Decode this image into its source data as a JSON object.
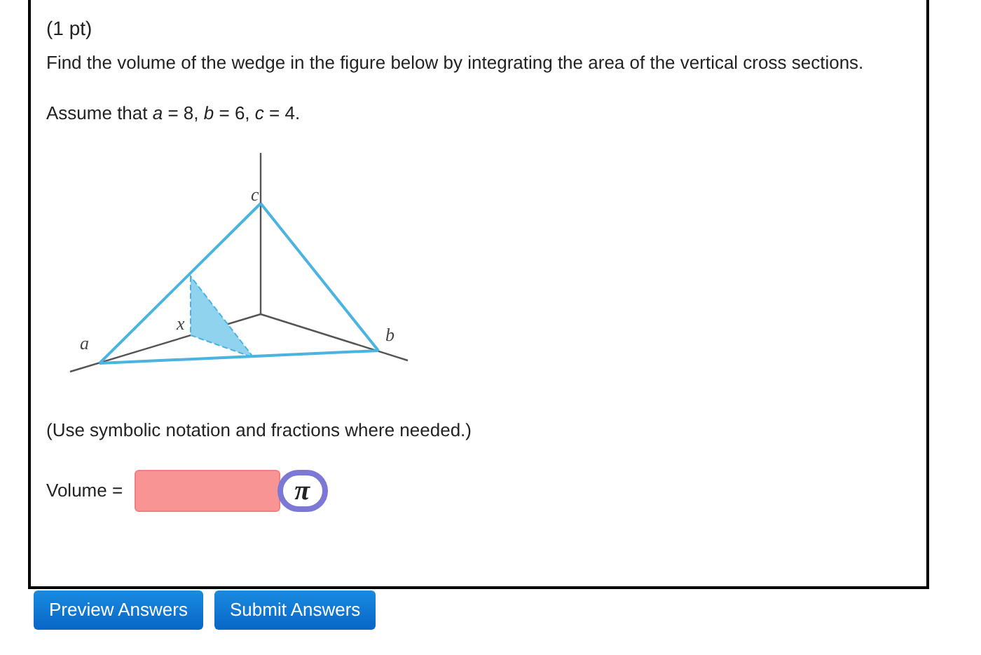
{
  "problem": {
    "points": "(1 pt)",
    "question": "Find the volume of the wedge in the figure below by integrating the area of the vertical cross sections.",
    "assumption": "Assume that *a* = 8, *b* = 6, *c* = 4.",
    "figure_labels": [
      {
        "kind": "c",
        "text": "c"
      },
      {
        "kind": "x",
        "text": "x"
      },
      {
        "kind": "a",
        "text": "a"
      },
      {
        "kind": "b",
        "text": "b"
      }
    ],
    "hint": "(Use symbolic notation and fractions where needed.)",
    "answer": {
      "label": "Volume =",
      "symbol": "π"
    }
  },
  "buttons": [
    "Preview Answers",
    "Submit Answers"
  ]
}
